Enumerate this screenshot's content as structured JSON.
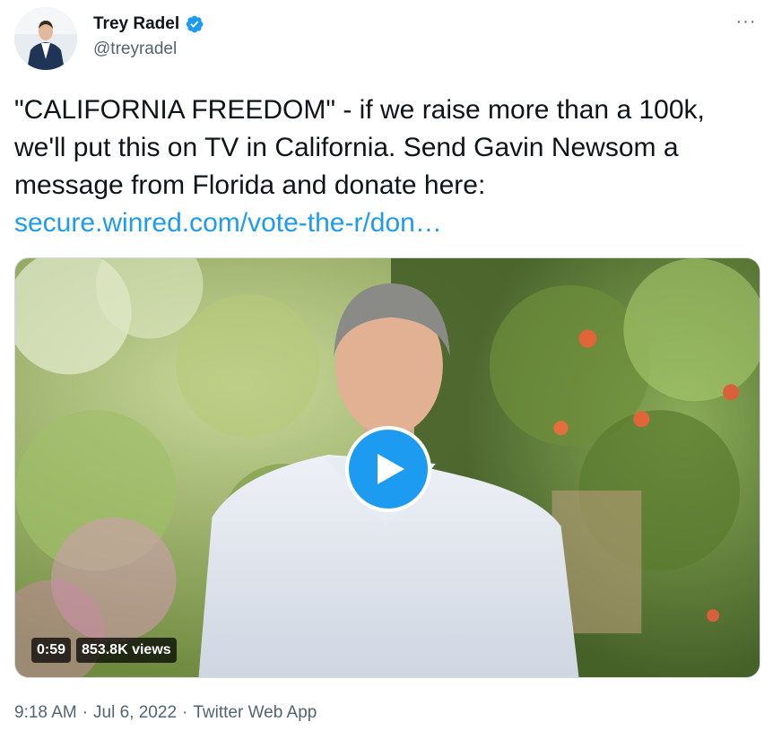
{
  "author": {
    "display_name": "Trey Radel",
    "handle": "@treyradel",
    "verified": true
  },
  "more_button": {
    "icon": "more-horizontal-icon",
    "label": "···"
  },
  "tweet": {
    "text": "\"CALIFORNIA FREEDOM\" - if we raise more than a 100k, we'll put this on TV in California. Send Gavin Newsom a message from Florida and donate here: ",
    "link_text": "secure.winred.com/vote-the-r/don…"
  },
  "media": {
    "type": "video",
    "duration": "0:59",
    "views": "853.8K views",
    "play_icon": "play-icon"
  },
  "footer": {
    "time": "9:18 AM",
    "separator1": "·",
    "date": "Jul 6, 2022",
    "separator2": "·",
    "source": "Twitter Web App"
  },
  "colors": {
    "link": "#1d9bf0",
    "secondary_text": "#536471",
    "primary_text": "#0f1419",
    "verified_badge": "#1d9bf0"
  }
}
